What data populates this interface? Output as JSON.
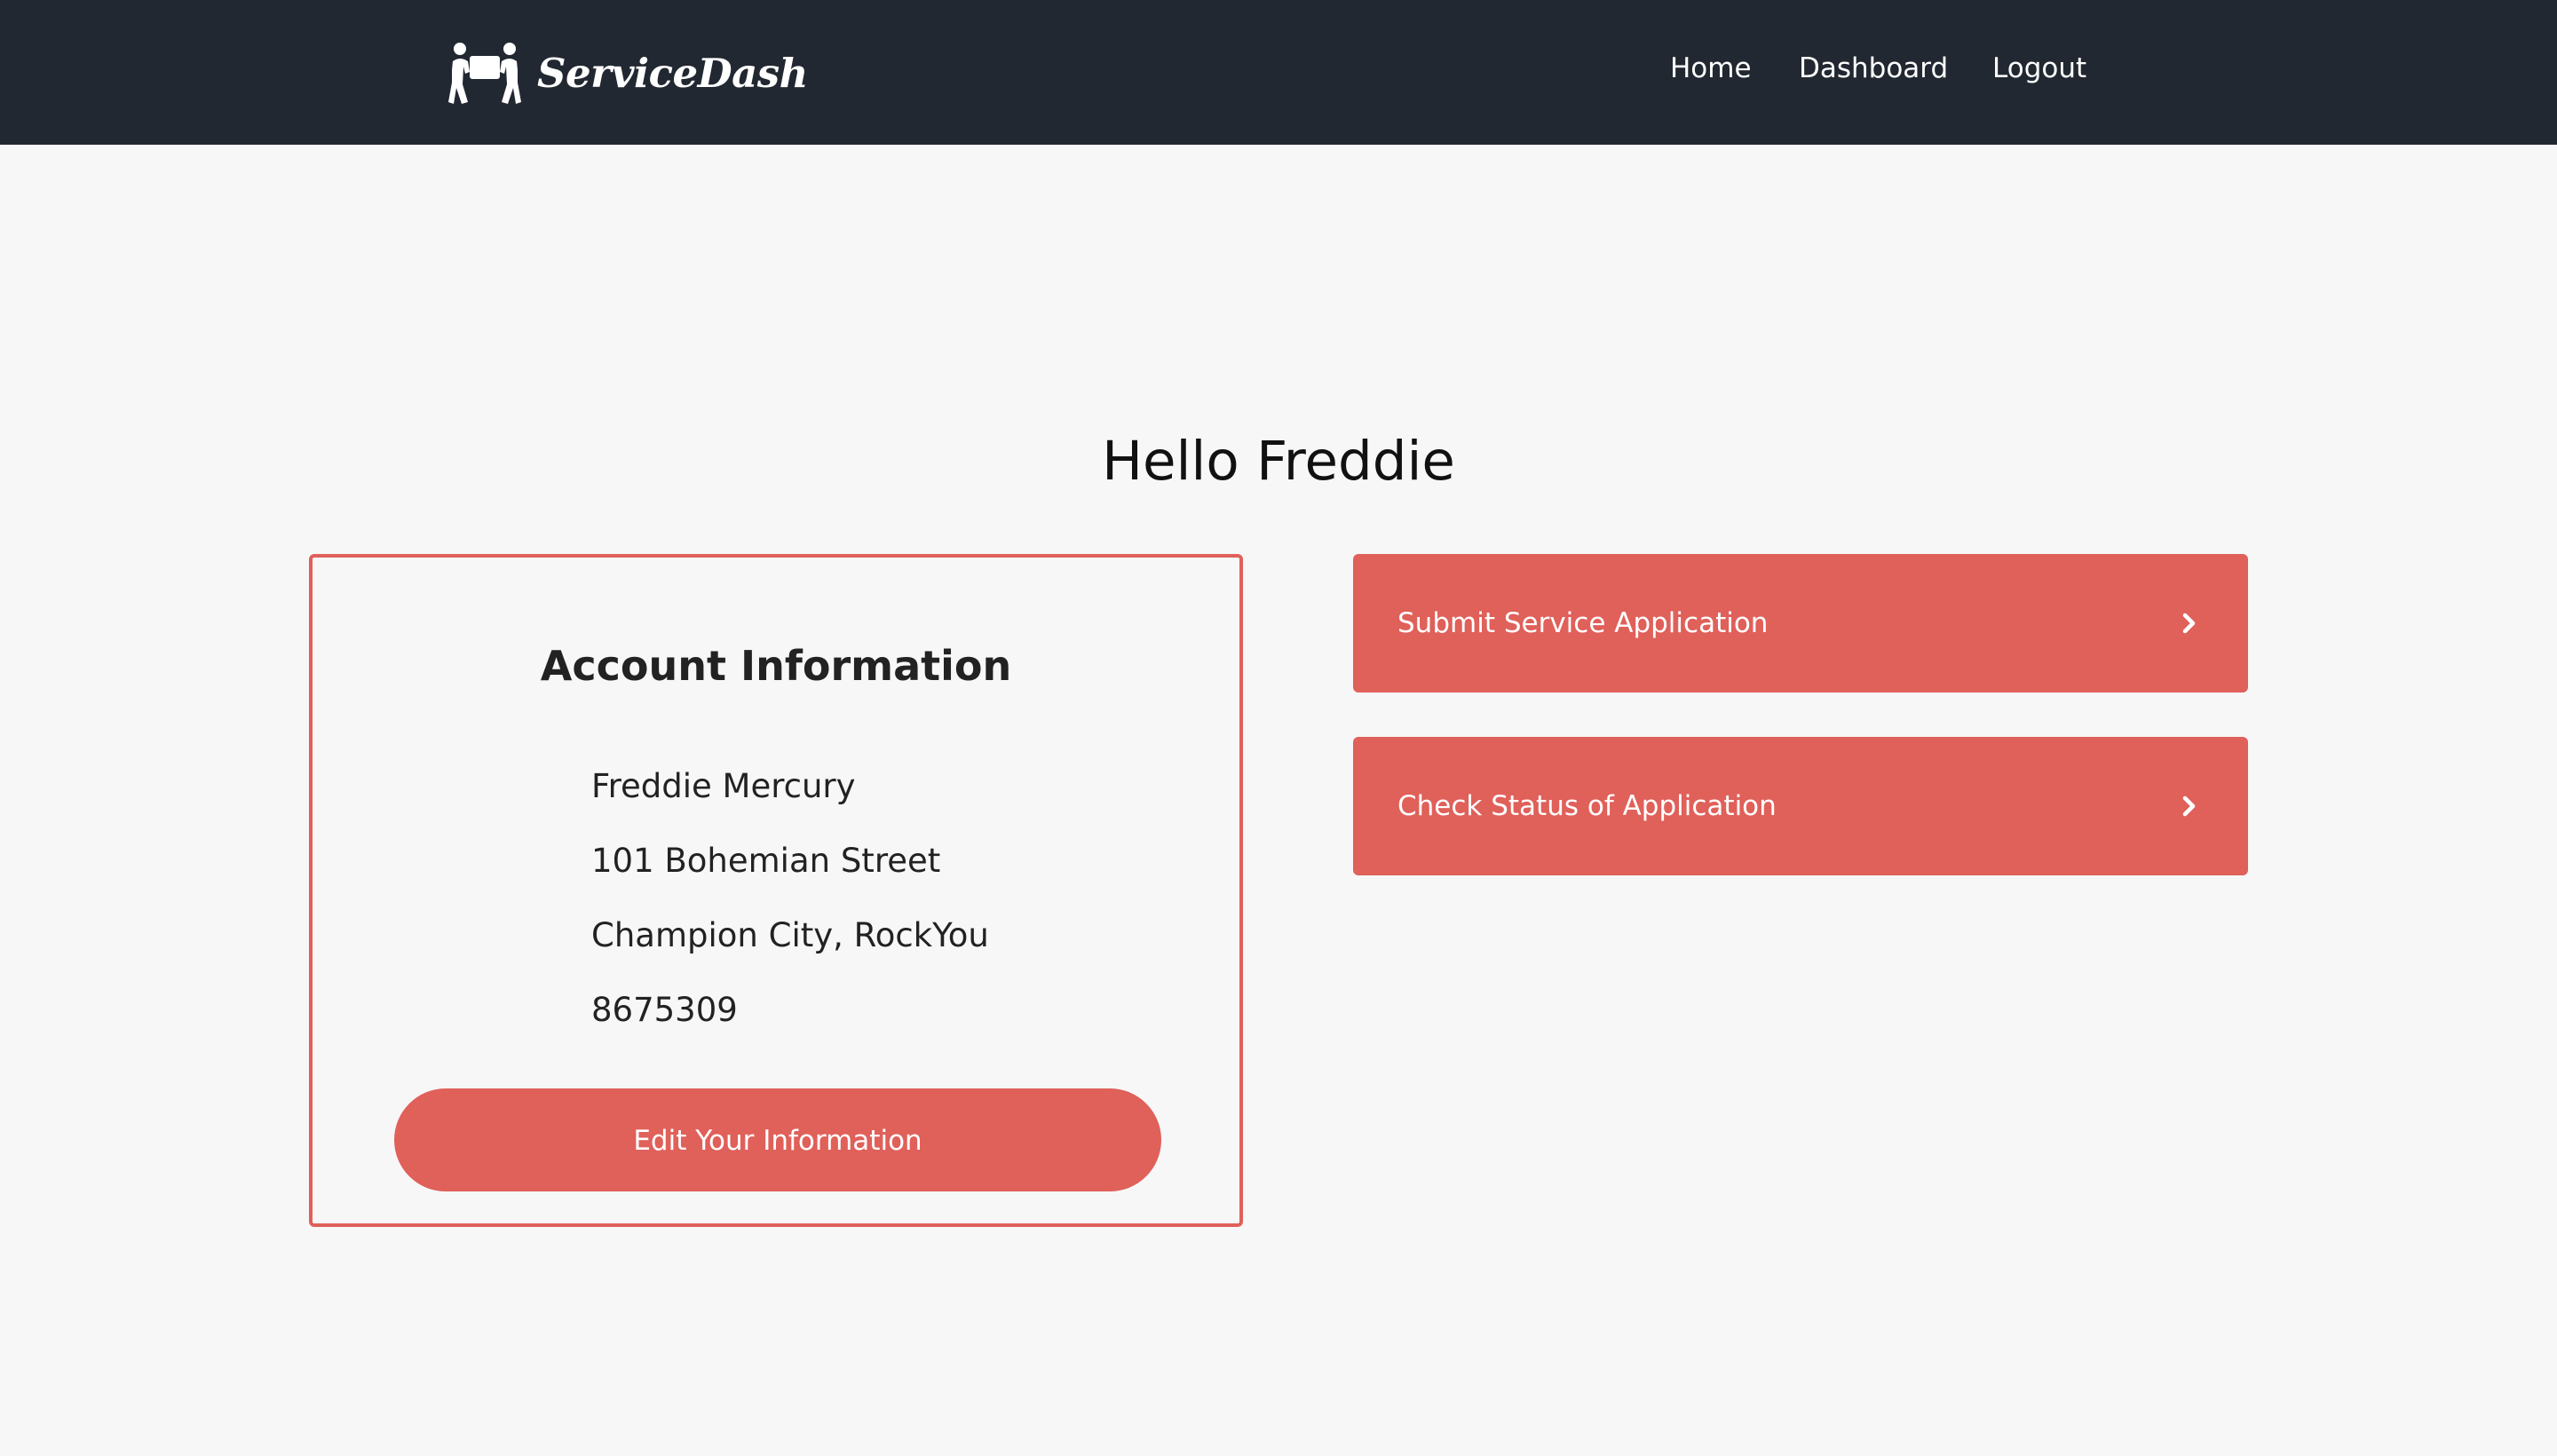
{
  "nav": {
    "brand": "ServiceDash",
    "links": [
      "Home",
      "Dashboard",
      "Logout"
    ]
  },
  "greeting": "Hello Freddie",
  "account": {
    "title": "Account Information",
    "name": "Freddie Mercury",
    "street": "101 Bohemian Street",
    "city": "Champion City, RockYou",
    "phone": "8675309",
    "edit_label": "Edit Your Information"
  },
  "actions": [
    {
      "label": "Submit Service Application",
      "icon": "chevron-right-icon"
    },
    {
      "label": "Check Status of Application",
      "icon": "chevron-right-icon"
    }
  ],
  "colors": {
    "navbar": "#222831",
    "accent": "#e0605a",
    "background": "#f7f7f7"
  }
}
